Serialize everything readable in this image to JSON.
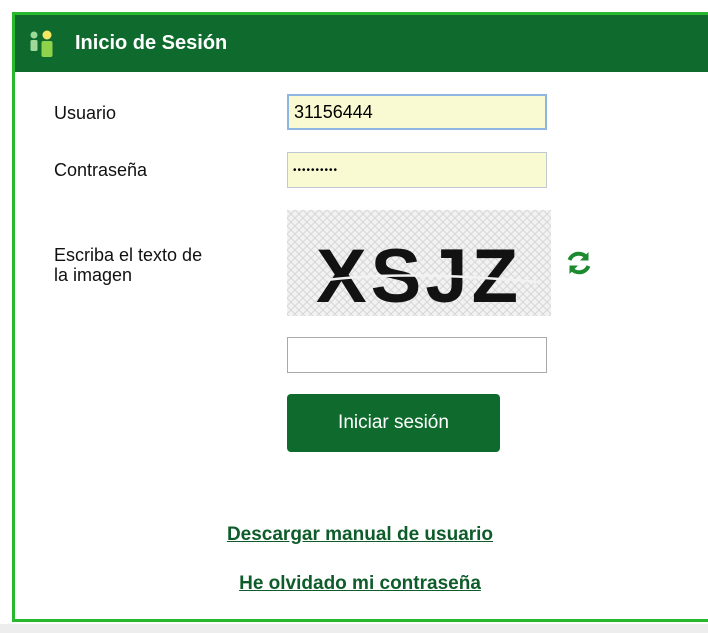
{
  "header": {
    "title": "Inicio de Sesión",
    "icon": "users-icon"
  },
  "form": {
    "usuario_label": "Usuario",
    "usuario_value": "31156444",
    "password_label": "Contraseña",
    "password_value": "••••••••••",
    "captcha_label_line1": "Escriba el texto de",
    "captcha_label_line2": "la imagen",
    "captcha_text": "XSJZ",
    "captcha_input_value": "",
    "submit_label": "Iniciar sesión"
  },
  "links": {
    "manual": "Descargar manual de usuario",
    "forgot": "He olvidado mi contraseña"
  },
  "colors": {
    "brand_green": "#0e6b2d",
    "border_green": "#27b82e",
    "input_fill": "#fafad2",
    "link_green": "#0e5c2a"
  }
}
